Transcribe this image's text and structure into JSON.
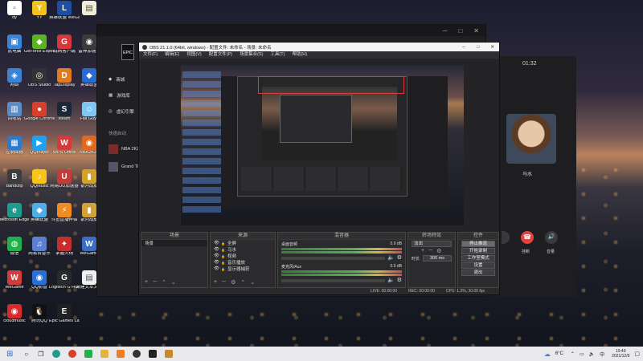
{
  "desktop": {
    "icons": [
      {
        "label": "dy",
        "color": "#ffffff",
        "glyph": "▫"
      },
      {
        "label": "YY",
        "color": "#f2c21b",
        "glyph": "Y"
      },
      {
        "label": "英雄联盟 WeGame版",
        "color": "#1d4fa3",
        "glyph": "L"
      },
      {
        "label": "",
        "color": "#f2ecd5",
        "glyph": "▤"
      },
      {
        "label": "此电脑",
        "color": "#3a84d6",
        "glyph": "▣"
      },
      {
        "label": "GeForce Experience",
        "color": "#5bb323",
        "glyph": "◆"
      },
      {
        "label": "战网客户端",
        "color": "#d6383a",
        "glyph": "G"
      },
      {
        "label": "雷神加速器",
        "color": "#3b3b3b",
        "glyph": "◉"
      },
      {
        "label": "网络",
        "color": "#3a84d6",
        "glyph": "◈"
      },
      {
        "label": "OBS Studio",
        "color": "#333333",
        "glyph": "◎"
      },
      {
        "label": "TapDisplay",
        "color": "#e07b1f",
        "glyph": "D"
      },
      {
        "label": "英雄联盟",
        "color": "#2a6bd1",
        "glyph": "◆"
      },
      {
        "label": "回收站",
        "color": "#5a8cc6",
        "glyph": "▥"
      },
      {
        "label": "Google Chrome",
        "color": "#d9402c",
        "glyph": "●"
      },
      {
        "label": "steam",
        "color": "#1b2838",
        "glyph": "S"
      },
      {
        "label": "Fall Guys",
        "color": "#7fc6f2",
        "glyph": "☺"
      },
      {
        "label": "控制面板",
        "color": "#2e79c9",
        "glyph": "▦"
      },
      {
        "label": "QQPlayer",
        "color": "#1da1f2",
        "glyph": "▶"
      },
      {
        "label": "WPS Office",
        "color": "#d63a3a",
        "glyph": "W"
      },
      {
        "label": "NBA2K20",
        "color": "#e0681f",
        "glyph": "◉"
      },
      {
        "label": "Bandizip",
        "color": "#3d3d3d",
        "glyph": "B"
      },
      {
        "label": "QQMusic",
        "color": "#f5c518",
        "glyph": "♪"
      },
      {
        "label": "网易UU加速器",
        "color": "#c43b3b",
        "glyph": "U"
      },
      {
        "label": "银河战舰",
        "color": "#d1a32a",
        "glyph": "▮"
      },
      {
        "label": "Microsoft Edge",
        "color": "#1d9b8f",
        "glyph": "e"
      },
      {
        "label": "英雄联盟",
        "color": "#4daee8",
        "glyph": "◆"
      },
      {
        "label": "斗鱼直播伴侣",
        "color": "#f08b22",
        "glyph": "⚡"
      },
      {
        "label": "银河战舰",
        "color": "#d3a236",
        "glyph": "▮"
      },
      {
        "label": "微信",
        "color": "#21b04b",
        "glyph": "◍"
      },
      {
        "label": "网易云音乐",
        "color": "#5d7fd1",
        "glyph": "♫"
      },
      {
        "label": "掌握火线",
        "color": "#c62e2e",
        "glyph": "✦"
      },
      {
        "label": "WeGame",
        "color": "#3a6ec6",
        "glyph": "W"
      },
      {
        "label": "WeGame",
        "color": "#d43c3c",
        "glyph": "W"
      },
      {
        "label": "QQ影音",
        "color": "#2870d6",
        "glyph": "◉"
      },
      {
        "label": "Logitech G HUB",
        "color": "#2a2a2a",
        "glyph": "G"
      },
      {
        "label": "新建文本文档",
        "color": "#f0f0f0",
        "glyph": "▤"
      },
      {
        "label": "cloudmusic",
        "color": "#d62b2b",
        "glyph": "◉"
      },
      {
        "label": "腾讯QQ",
        "color": "#111111",
        "glyph": "🐧"
      },
      {
        "label": "Epic Games Launcher",
        "color": "#222222",
        "glyph": "E"
      }
    ]
  },
  "epic": {
    "items": [
      "商城",
      "游戏库",
      "虚幻引擎"
    ],
    "section": "快速启动",
    "quick": [
      "NBA 2K21",
      "Grand Theft"
    ]
  },
  "obs": {
    "title": "OBS 21.1.0 (64bit, windows) - 配置文件: 未命名 - 场景: 未命名",
    "menu": [
      "文件(F)",
      "编辑(E)",
      "视图(V)",
      "配置文件(P)",
      "场景集合(S)",
      "工具(T)",
      "帮助(H)"
    ],
    "docks": {
      "scenes": "场景",
      "sources": "来源",
      "mixer": "混音器",
      "transitions": "转场特效",
      "controls": "控件"
    },
    "scenes": [
      "场景"
    ],
    "sources": [
      "全屏",
      "马水",
      "视频",
      "音乐播放",
      "显示器捕获"
    ],
    "mixer": [
      {
        "name": "桌面音频",
        "db": "0.0 dB"
      },
      {
        "name": "麦克风/Aux",
        "db": "0.0 dB"
      }
    ],
    "transition": {
      "type": "淡出",
      "duration_label": "时长",
      "duration": "300 ms"
    },
    "controls": [
      "停止推流",
      "开始录制",
      "工作室模式",
      "设置",
      "退出"
    ],
    "status": {
      "live": "LIVE: 00:00:00",
      "rec": "REC: 00:00:00",
      "cpu": "CPU: 1.3%, 30.00 fps"
    }
  },
  "call": {
    "timer": "01:32",
    "name": "马水",
    "hangup": "挂断",
    "volume": "音量"
  },
  "taskbar": {
    "weather": "6°C",
    "time": "19:49",
    "date": "2021/12/9"
  }
}
